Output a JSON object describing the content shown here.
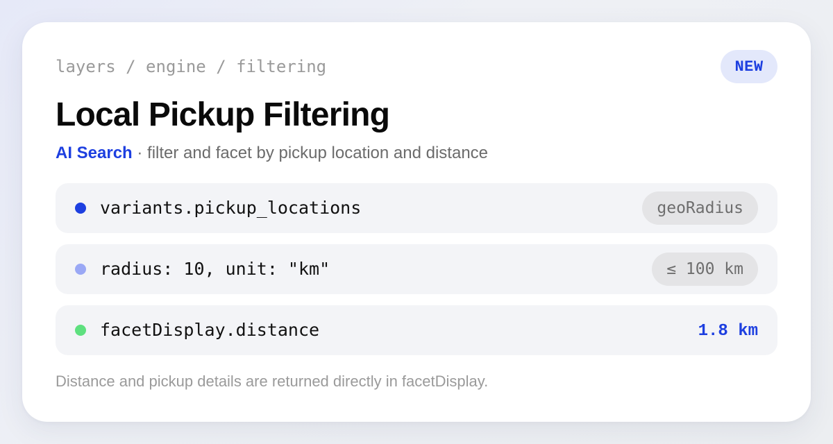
{
  "breadcrumb": "layers / engine / filtering",
  "badge": "NEW",
  "title": "Local Pickup Filtering",
  "subtitle": {
    "brand": "AI Search",
    "separator": " · ",
    "description": "filter and facet by pickup location and distance"
  },
  "rows": [
    {
      "code": "variants.pickup_locations",
      "tag": "geoRadius",
      "dot_color": "#1d3fe0"
    },
    {
      "code": "radius: 10, unit: \"km\"",
      "tag": "≤ 100 km",
      "dot_color": "#9aa8f5"
    },
    {
      "code": "facetDisplay.distance",
      "value": "1.8 km",
      "dot_color": "#5ee07f"
    }
  ],
  "footer": "Distance and pickup details are returned directly in facetDisplay.",
  "colors": {
    "accent": "#1d3fe0",
    "badge_bg": "#e3e8fb",
    "row_bg": "#f3f4f7",
    "pill_bg": "#e4e4e6"
  }
}
